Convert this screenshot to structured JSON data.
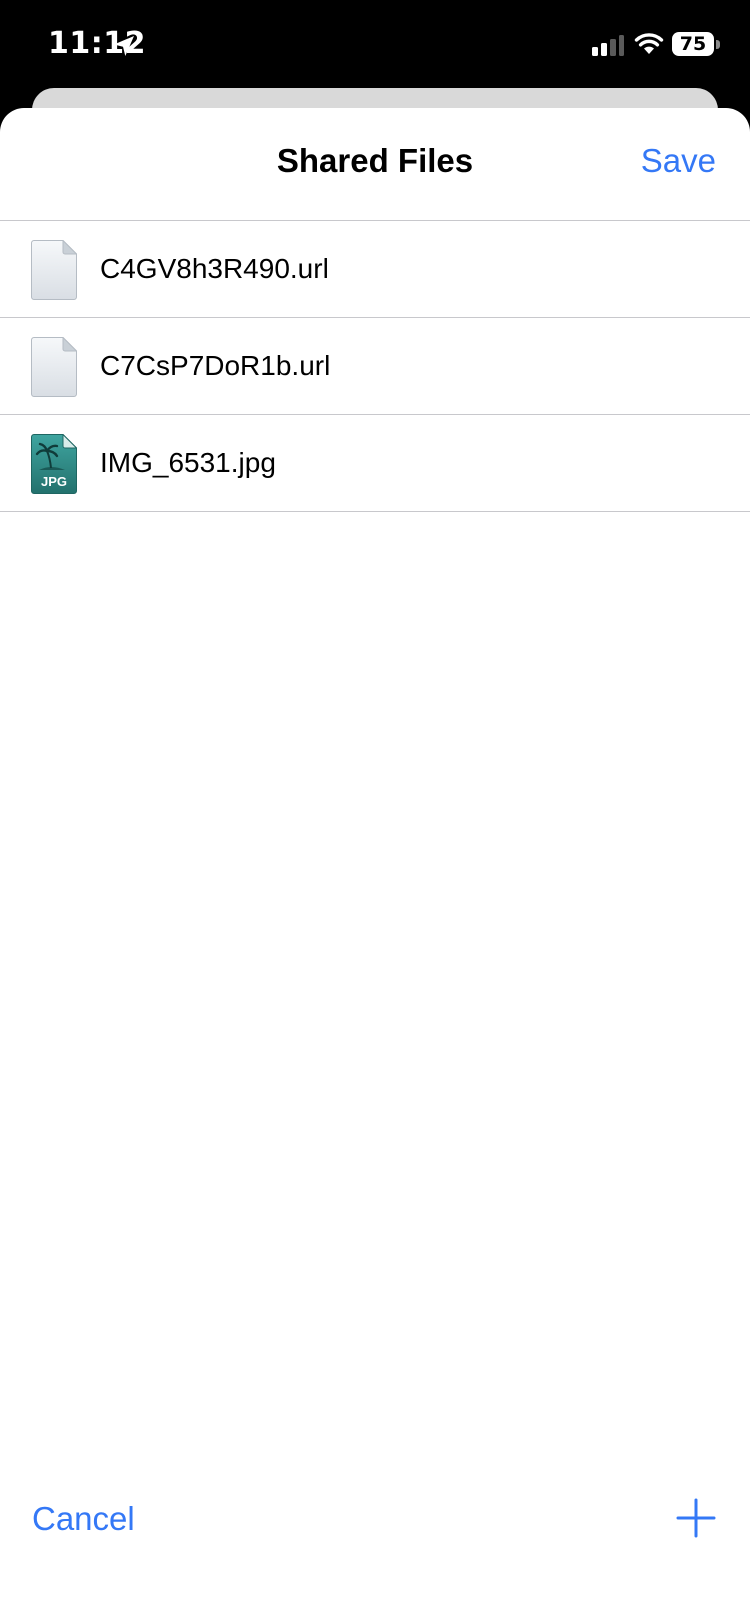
{
  "status_bar": {
    "time": "11:12",
    "battery": "75",
    "icons": [
      "location-arrow-icon",
      "cellular-signal-icon",
      "wifi-icon",
      "battery-icon"
    ]
  },
  "sheet": {
    "title": "Shared Files",
    "save_label": "Save",
    "cancel_label": "Cancel",
    "add_icon": "plus-icon"
  },
  "files": [
    {
      "name": "C4GV8h3R490.url",
      "icon": "generic-file-icon"
    },
    {
      "name": "C7CsP7DoR1b.url",
      "icon": "generic-file-icon"
    },
    {
      "name": "IMG_6531.jpg",
      "icon": "jpg-file-icon",
      "icon_label": "JPG"
    }
  ],
  "colors": {
    "accent": "#3478f6",
    "jpg_icon": "#2e8f8a",
    "separator": "#c8c8cc"
  }
}
